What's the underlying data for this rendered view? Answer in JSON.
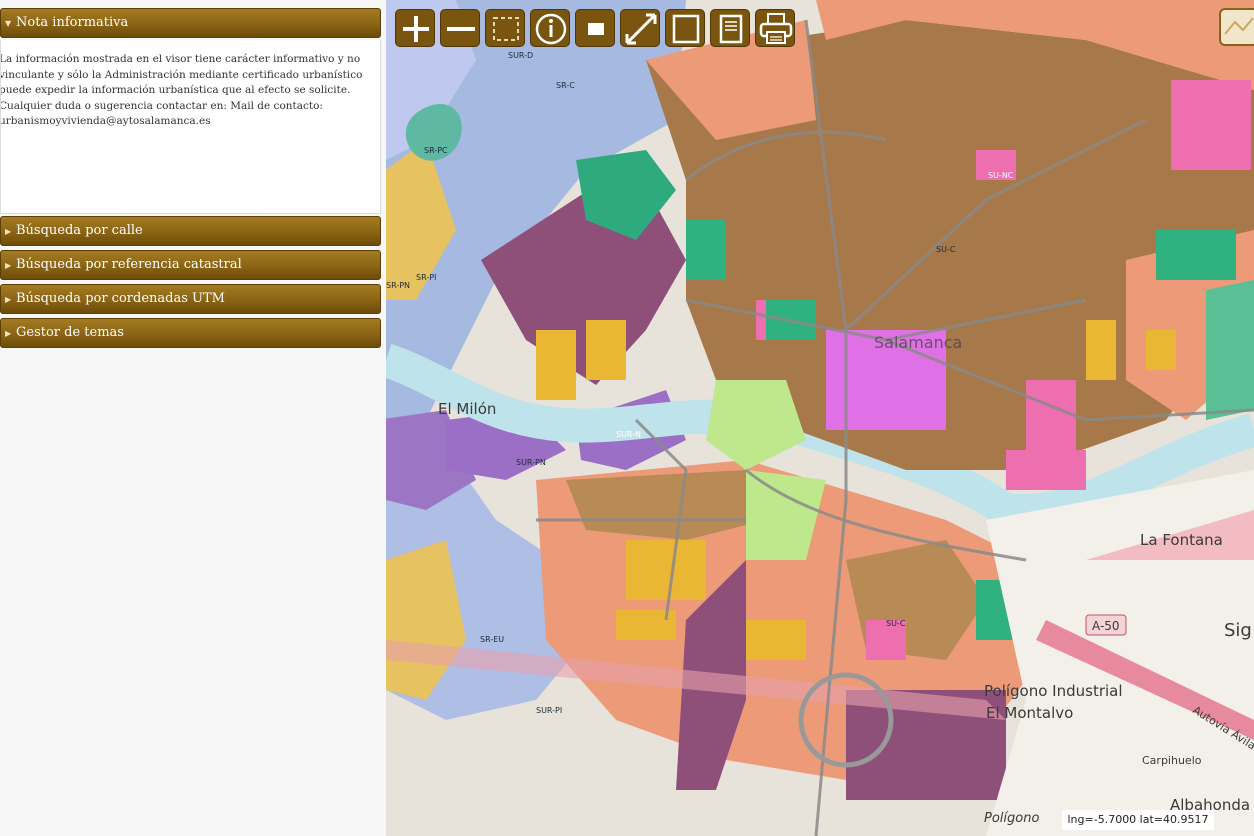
{
  "panel": {
    "nota": {
      "title": "Nota informativa",
      "text": "La información mostrada en el visor tiene carácter informativo y no\nvinculante y sólo la Administración mediante certificado urbanístico\npuede expedir la información urbanística que al efecto se solicite.\nCualquier duda o sugerencia contactar en: Mail de contacto:\nurbanismoyvivienda@aytosalamanca.es"
    },
    "sections": [
      {
        "label": "Búsqueda por calle"
      },
      {
        "label": "Búsqueda por referencia catastral"
      },
      {
        "label": "Búsqueda por cordenadas UTM"
      },
      {
        "label": "Gestor de temas"
      }
    ]
  },
  "toolbar": {
    "tools": [
      {
        "icon": "zoom-in-icon"
      },
      {
        "icon": "zoom-out-icon"
      },
      {
        "icon": "zoom-box-icon"
      },
      {
        "icon": "info-icon"
      },
      {
        "icon": "select-icon"
      },
      {
        "icon": "measure-icon"
      },
      {
        "icon": "extent-icon"
      },
      {
        "icon": "document-icon"
      },
      {
        "icon": "print-icon"
      }
    ]
  },
  "map": {
    "zone_labels": [
      "SUR-D",
      "SR-C",
      "SR-PC",
      "SR-PI",
      "SR-PN",
      "SR-EU",
      "SUR-N",
      "SUR-PN",
      "SUR-PI",
      "SU-NC",
      "SU-C",
      "SU-C"
    ],
    "place_labels": {
      "salamanca": "Salamanca",
      "el_milon": "El Milón",
      "la_fontana": "La Fontana",
      "poligono": "Polígono Industrial",
      "el_montalvo": "El Montalvo",
      "carpihuelo": "Carpihuelo",
      "albahonda": "Albahonda",
      "poligono2": "Polígono",
      "a50": "A-50",
      "autovia": "Autovía Ávila-",
      "sig": "Sig"
    },
    "coords": "lng=-5.7000 lat=40.9517"
  },
  "colors": {
    "header_gold": "#8a6414",
    "pink_sunc": "#ee6fb0",
    "brown_urban": "#a07040",
    "salmon": "#ec9a78",
    "purple_sur": "#8e5079",
    "blue_river": "#b7d9ec"
  }
}
